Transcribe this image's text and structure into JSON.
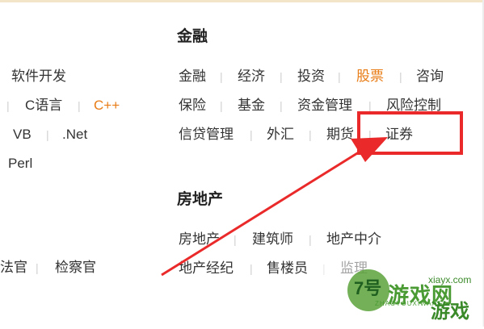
{
  "left_column": {
    "row1": [
      "软件开发"
    ],
    "row2": [
      "C语言",
      "C++"
    ],
    "row3": [
      "VB",
      ".Net"
    ],
    "row4": [
      "Perl"
    ],
    "row5": [
      "法官",
      "检察官"
    ]
  },
  "finance": {
    "title": "金融",
    "row1": [
      "金融",
      "经济",
      "投资",
      "股票",
      "咨询"
    ],
    "row2": [
      "保险",
      "基金",
      "资金管理",
      "风险控制"
    ],
    "row3": [
      "信贷管理",
      "外汇",
      "期货",
      "证券"
    ]
  },
  "real_estate": {
    "title": "房地产",
    "row1": [
      "房地产",
      "建筑师",
      "地产中介"
    ],
    "row2": [
      "地产经纪",
      "售楼员",
      "监理"
    ]
  },
  "watermark": {
    "badge": "7号",
    "name": "游戏网",
    "url": "xiayx.com",
    "pinyin": "ZHAOYOUXIWANG",
    "sub": "游戏"
  },
  "colors": {
    "accent": "#e87c16",
    "highlight": "#ea2a2a",
    "text": "#333333",
    "watermark": "#4a9b34"
  }
}
